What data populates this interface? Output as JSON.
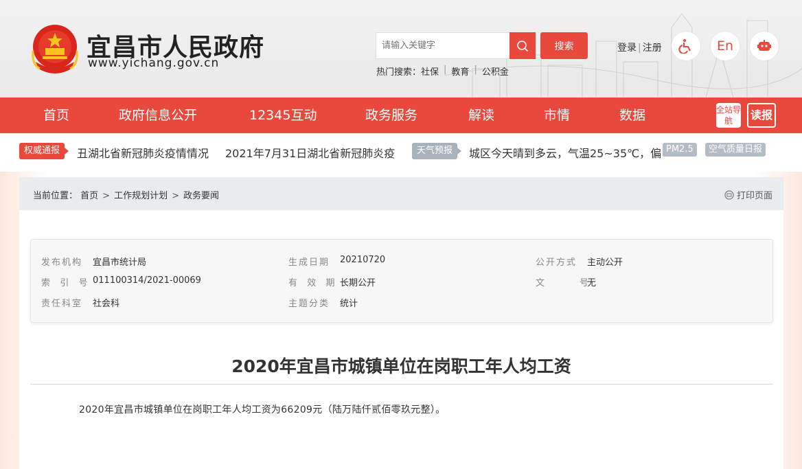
{
  "header": {
    "site_title": "宜昌市人民政府",
    "site_url": "www.yichang.gov.cn",
    "search_placeholder": "请输入关键字",
    "search_button": "搜索",
    "hot_label": "热门搜索：",
    "hot_items": [
      "社保",
      "教育",
      "公积金"
    ],
    "login": "登录",
    "register": "注册",
    "english": "En"
  },
  "nav": {
    "items": [
      "首页",
      "政府信息公开",
      "12345互动",
      "政务服务",
      "解读",
      "市情",
      "数据"
    ],
    "sitemap": "全站导航",
    "reader": "读报"
  },
  "ticker": {
    "tag1": "权威通报",
    "news1": "丑湖北省新冠肺炎疫情情况",
    "news2": "2021年7月31日湖北省新冠肺炎疫",
    "tag2": "天气预报",
    "weather": "城区今天晴到多云，气温25~35℃，偏",
    "pm": "PM2.5",
    "aqi": "空气质量日报"
  },
  "breadcrumb": {
    "label": "当前位置：",
    "items": [
      "首页",
      "工作规划计划",
      "政务要闻"
    ],
    "print": "打印页面"
  },
  "meta": {
    "publisher_label": "发布机构",
    "publisher": "宜昌市统计局",
    "date_label": "生成日期",
    "date": "20210720",
    "open_label": "公开方式",
    "open": "主动公开",
    "index_label": "索  引  号",
    "index": "011100314/2021-00069",
    "valid_label": "有  效  期",
    "valid": "长期公开",
    "doc_label": "文        号",
    "doc": "无",
    "dept_label": "责任科室",
    "dept": "社会科",
    "topic_label": "主题分类",
    "topic": "统计"
  },
  "article": {
    "title": "2020年宜昌市城镇单位在岗职工年人均工资",
    "body": "2020年宜昌市城镇单位在岗职工年人均工资为66209元（陆万陆仟贰佰零玖元整）。"
  }
}
